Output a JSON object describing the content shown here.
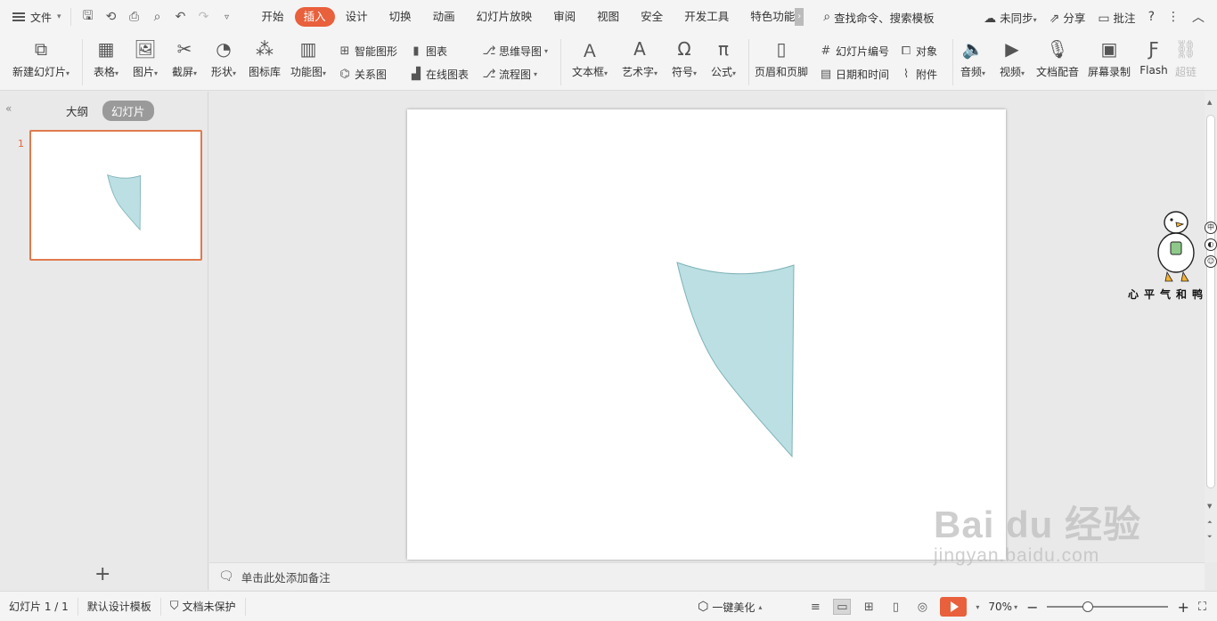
{
  "menubar": {
    "file_label": "文件",
    "tabs": [
      "开始",
      "插入",
      "设计",
      "切换",
      "动画",
      "幻灯片放映",
      "审阅",
      "视图",
      "安全",
      "开发工具",
      "特色功能"
    ],
    "active_tab": "插入",
    "search_label": "查找命令、搜索模板",
    "sync_label": "未同步",
    "share_label": "分享",
    "comment_label": "批注"
  },
  "ribbon": {
    "new_slide": "新建幻灯片",
    "table": "表格",
    "picture": "图片",
    "screenshot": "截屏",
    "shape": "形状",
    "icon_lib": "图标库",
    "func_chart": "功能图",
    "smart_art": "智能图形",
    "relation": "关系图",
    "chart": "图表",
    "online_chart": "在线图表",
    "mindmap": "思维导图",
    "flowchart": "流程图",
    "textbox": "文本框",
    "wordart": "艺术字",
    "symbol": "符号",
    "formula": "公式",
    "header_footer": "页眉和页脚",
    "slide_number": "幻灯片编号",
    "datetime": "日期和时间",
    "object": "对象",
    "attachment": "附件",
    "audio": "音频",
    "video": "视频",
    "doc_dub": "文档配音",
    "screen_rec": "屏幕录制",
    "flash": "Flash",
    "hyperlink": "超链"
  },
  "leftpanel": {
    "outline_tab": "大纲",
    "slides_tab": "幻灯片",
    "slide_number": "1"
  },
  "notes": {
    "placeholder": "单击此处添加备注"
  },
  "mascot": {
    "caption": "心平气和鸭"
  },
  "status": {
    "slide_info": "幻灯片 1 / 1",
    "template": "默认设计模板",
    "protect": "文档未保护",
    "beautify": "一键美化",
    "zoom": "70%"
  },
  "watermark": {
    "line1": "Bai du 经验",
    "line2": "jingyan.baidu.com"
  },
  "colors": {
    "accent": "#e8603c",
    "shape_fill": "#bbdfe2",
    "shape_stroke": "#7fb2b8"
  }
}
